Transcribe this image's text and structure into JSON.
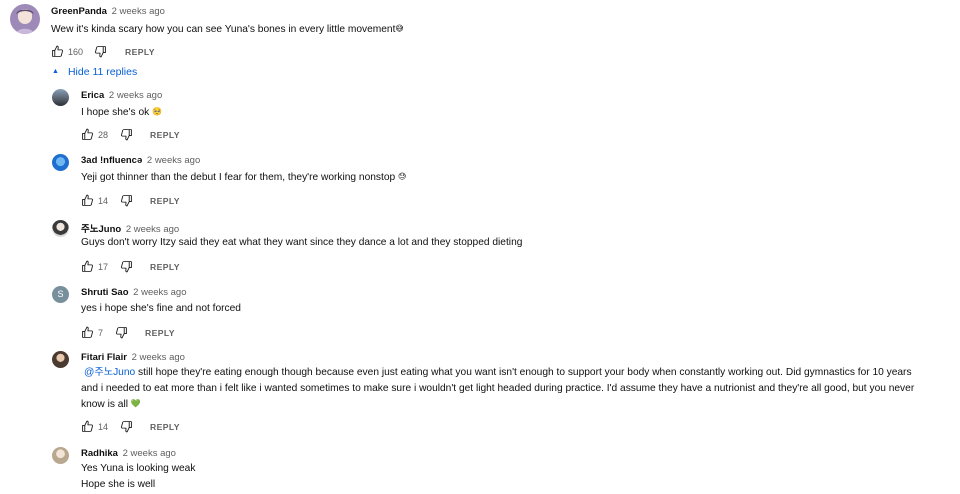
{
  "top_comment": {
    "author": "GreenPanda",
    "time": "2 weeks ago",
    "text": "Wew it's kinda scary how you can see Yuna's bones in every little movement",
    "emoji": "😅",
    "likes": "160",
    "reply_label": "REPLY"
  },
  "hide_replies_label": "Hide 11 replies",
  "replies": [
    {
      "author": "Erica",
      "time": "2 weeks ago",
      "text": "I hope she's ok",
      "emoji": "🥺",
      "likes": "28",
      "reply_label": "REPLY"
    },
    {
      "author": "3ad !nfluencə",
      "time": "2 weeks ago",
      "text": "Yeji got thinner than the debut I fear for them, they're working nonstop",
      "emoji": "😓",
      "likes": "14",
      "reply_label": "REPLY"
    },
    {
      "author": "주노Juno",
      "time": "2 weeks ago",
      "text": "Guys don't worry Itzy said they eat what they want since they dance a lot and they stopped dieting",
      "likes": "17",
      "reply_label": "REPLY"
    },
    {
      "author": "Shruti Sao",
      "avatar_letter": "S",
      "time": "2 weeks ago",
      "text": "yes i hope she's fine and not forced",
      "likes": "7",
      "reply_label": "REPLY"
    },
    {
      "author": "Fitari Flair",
      "time": "2 weeks ago",
      "mention": "@주노Juno",
      "text_line1": " still hope they're eating enough though because even just eating what you want isn't enough to support your body when constantly working out. Did gymnastics for 10 years",
      "text_line2": "and i needed to eat more than i felt like i wanted sometimes to make sure i wouldn't get light headed during practice. I'd assume they have a nutrionist and they're all good, but you never",
      "text_line3": "know is all",
      "emoji": "💚",
      "likes": "14",
      "reply_label": "REPLY"
    },
    {
      "author": "Radhika",
      "time": "2 weeks ago",
      "text_line1": "Yes Yuna is looking weak",
      "text_line2": "Hope she is well"
    }
  ],
  "icons": {
    "like": "thumbs-up-icon",
    "dislike": "thumbs-down-icon",
    "collapse": "caret-up-icon"
  },
  "colors": {
    "link": "#065fd4",
    "meta": "#606060",
    "text": "#0f0f0f"
  }
}
